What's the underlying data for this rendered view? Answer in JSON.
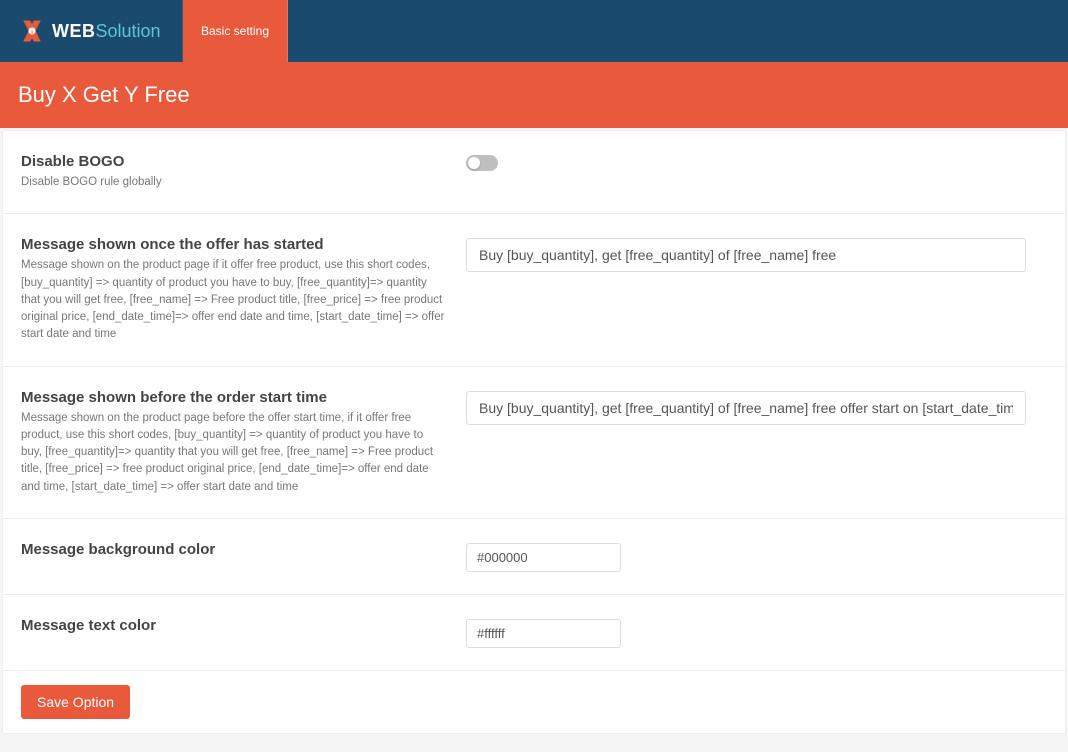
{
  "header": {
    "logo_text_1": "WEB",
    "logo_text_2": "Solution",
    "nav_tab": "Basic setting"
  },
  "page_title": "Buy X Get Y Free",
  "settings": {
    "disable_bogo": {
      "label": "Disable BOGO",
      "desc": "Disable BOGO rule globally"
    },
    "msg_started": {
      "label": "Message shown once the offer has started",
      "desc": "Message shown on the product page if it offer free product, use this short codes, [buy_quantity] => quantity of product you have to buy, [free_quantity]=> quantity that you will get free, [free_name] => Free product title, [free_price] => free product original price, [end_date_time]=> offer end date and time, [start_date_time] => offer start date and time",
      "value": "Buy [buy_quantity], get [free_quantity] of [free_name] free"
    },
    "msg_before": {
      "label": "Message shown before the order start time",
      "desc": "Message shown on the product page before the offer start time, if it offer free product, use this short codes, [buy_quantity] => quantity of product you have to buy, [free_quantity]=> quantity that you will get free, [free_name] => Free product title, [free_price] => free product original price, [end_date_time]=> offer end date and time, [start_date_time] => offer start date and time",
      "value": "Buy [buy_quantity], get [free_quantity] of [free_name] free offer start on [start_date_time]"
    },
    "bg_color": {
      "label": "Message background color",
      "value": "#000000"
    },
    "text_color": {
      "label": "Message text color",
      "value": "#ffffff"
    }
  },
  "save_button": "Save Option"
}
